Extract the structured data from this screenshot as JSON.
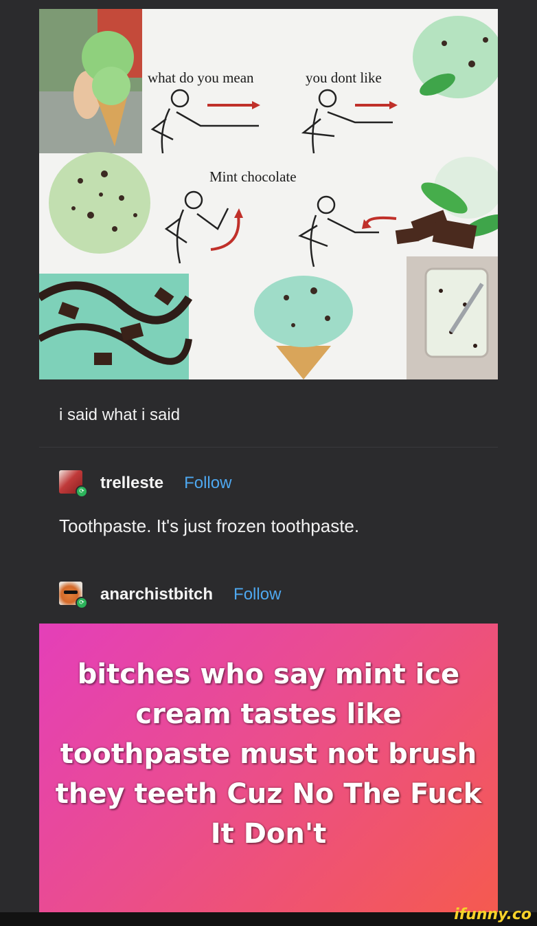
{
  "meme": {
    "line1_left": "what do you mean",
    "line1_right": "you dont like",
    "line2": "Mint chocolate",
    "colors": {
      "mint": "#a8d8a4",
      "chocolate": "#4a2a1e",
      "cone": "#d9a55a",
      "arrow": "#c0302a"
    }
  },
  "post": {
    "caption": "i said what i said"
  },
  "reblogs": [
    {
      "username": "trelleste",
      "follow_label": "Follow",
      "text": "Toothpaste. It's just frozen toothpaste."
    },
    {
      "username": "anarchistbitch",
      "follow_label": "Follow"
    }
  ],
  "card": {
    "text": "bitches who say mint ice cream tastes like toothpaste must not brush they teeth Cuz No The Fuck It Don't",
    "gradient": [
      "#e43fb9",
      "#f55a4f"
    ]
  },
  "watermark": "ifunny.co"
}
